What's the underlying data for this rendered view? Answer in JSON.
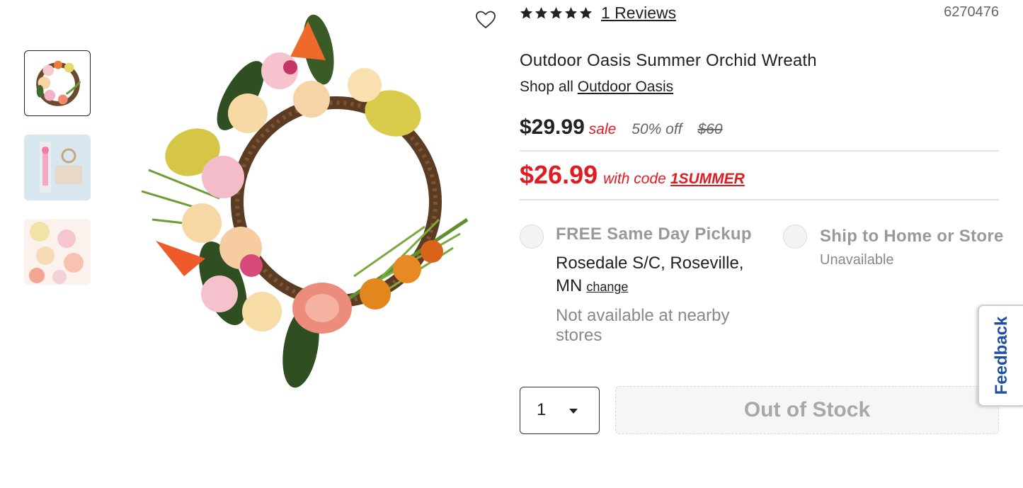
{
  "gallery": {
    "thumbnails": [
      {
        "label": "wreath-front",
        "selected": true
      },
      {
        "label": "wreath-packaging",
        "selected": false
      },
      {
        "label": "wreath-closeup",
        "selected": false
      }
    ],
    "main_image": "tropical-orchid-wreath"
  },
  "product": {
    "rating": {
      "stars": 5,
      "reviews_text": "1 Reviews"
    },
    "web_id": "6270476",
    "title": "Outdoor Oasis Summer Orchid Wreath",
    "shop_all_prefix": "Shop all",
    "shop_all_link": "Outdoor Oasis"
  },
  "pricing": {
    "sale_price": "$29.99",
    "sale_label": "sale",
    "percent_off": "50% off",
    "original_price": "$60",
    "promo_price": "$26.99",
    "promo_with": "with code",
    "promo_code": "1SUMMER"
  },
  "fulfillment": {
    "pickup": {
      "title": "FREE Same Day Pickup",
      "store_line1": "Rosedale S/C, Roseville,",
      "store_line2": "MN",
      "change_label": "change",
      "availability": "Not available at nearby stores"
    },
    "ship": {
      "title": "Ship to Home or Store",
      "status": "Unavailable"
    }
  },
  "purchase": {
    "quantity": "1",
    "button_label": "Out of Stock"
  },
  "feedback_tab": "Feedback",
  "colors": {
    "sale_red": "#e11b22",
    "feedback_blue": "#1e4fa6",
    "disabled_gray": "#a8a8a8"
  },
  "icons": [
    "heart-outline-icon",
    "star-filled-icon",
    "caret-down-icon"
  ]
}
